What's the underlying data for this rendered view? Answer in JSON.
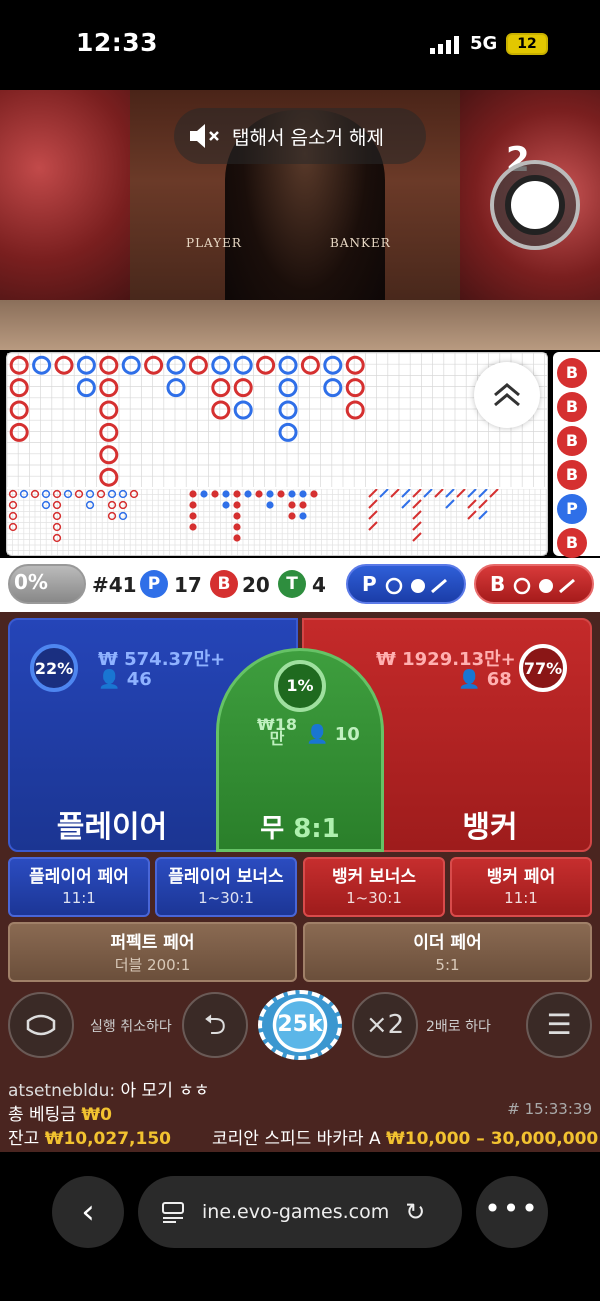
{
  "status_bar": {
    "time": "12:33",
    "network": "5G",
    "battery": "12"
  },
  "video": {
    "unmute_text": "탭해서 음소거 해제",
    "countdown": "2",
    "table_player": "PLAYER",
    "table_banker": "BANKER"
  },
  "roadmap": {
    "big_road": [
      [
        "B",
        "B",
        "B",
        "B"
      ],
      [
        "P"
      ],
      [
        "B"
      ],
      [
        "P",
        "P"
      ],
      [
        "B",
        "B",
        "B",
        "B",
        "B",
        "B"
      ],
      [
        "P"
      ],
      [
        "B"
      ],
      [
        "P",
        "P"
      ],
      [
        "B"
      ],
      [
        "P",
        "B",
        "B"
      ],
      [
        "P",
        "B",
        "P"
      ],
      [
        "B"
      ],
      [
        "P",
        "P",
        "P",
        "P"
      ],
      [
        "B"
      ],
      [
        "P",
        "P"
      ],
      [
        "B",
        "B",
        "B"
      ]
    ],
    "bead_road": [
      "B",
      "B",
      "B",
      "B",
      "P",
      "B"
    ]
  },
  "stats": {
    "percent": "0%",
    "round": "#41",
    "player_letter": "P",
    "player_count": "17",
    "banker_letter": "B",
    "banker_count": "20",
    "tie_letter": "T",
    "tie_count": "4"
  },
  "predict": {
    "player_label": "P",
    "banker_label": "B"
  },
  "bets": {
    "player": {
      "label": "플레이어",
      "pct": "22%",
      "amount": "₩ 574.37만+",
      "users": "46"
    },
    "banker": {
      "label": "뱅커",
      "pct": "77%",
      "amount": "₩ 1929.13만+",
      "users": "68"
    },
    "tie": {
      "label": "무",
      "odds": "8:1",
      "pct": "1%",
      "amount_line1": "18",
      "amount_line2": "만",
      "currency": "₩",
      "users": "10"
    },
    "side": [
      {
        "label": "플레이어 페어",
        "odds": "11:1"
      },
      {
        "label": "플레이어 보너스",
        "odds": "1~30:1"
      },
      {
        "label": "뱅커 보너스",
        "odds": "1~30:1"
      },
      {
        "label": "뱅커 페어",
        "odds": "11:1"
      }
    ],
    "perfect_pair": {
      "label": "퍼펙트 페어",
      "odds": "더블 200:1"
    },
    "either_pair": {
      "label": "이더 페어",
      "odds": "5:1"
    }
  },
  "controls": {
    "undo_label": "실행 취소하다",
    "chip_value": "25k",
    "double_symbol": "×2",
    "double_label": "2배로 하다"
  },
  "info": {
    "chat_user": "atsetnebldu:",
    "chat_message": "아 모기 ㅎㅎ",
    "total_bet_label": "총 베팅금",
    "total_bet_value": "₩0",
    "balance_label": "잔고",
    "balance_value": "₩10,027,150",
    "time": "# 15:33:39",
    "table_name": "코리안 스피드 바카라 A",
    "limits": "₩10,000 – 30,000,000"
  },
  "browser": {
    "url": "ine.evo-games.com"
  },
  "colors": {
    "player": "#2545b8",
    "banker": "#c42a2a",
    "tie": "#3e9e3e",
    "gold": "#f2c230"
  }
}
